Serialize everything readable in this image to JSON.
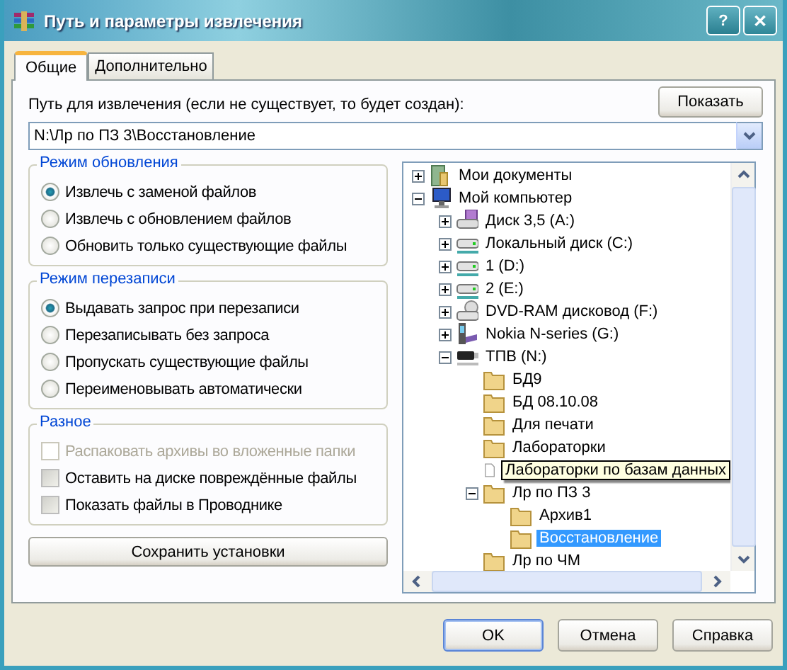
{
  "window": {
    "title": "Путь и параметры извлечения",
    "buttons": [
      {
        "kind": "help",
        "label": "?"
      },
      {
        "kind": "close",
        "label": "✕"
      }
    ]
  },
  "tabs": [
    {
      "label": "Общие",
      "selected": true
    },
    {
      "label": "Дополнительно",
      "selected": false
    }
  ],
  "path": {
    "label": "Путь для извлечения (если не существует, то будет создан):",
    "show_button": "Показать",
    "value": "N:\\Лр по ПЗ 3\\Восстановление"
  },
  "groups": [
    {
      "title": "Режим обновления",
      "options": [
        {
          "label": "Извлечь с заменой файлов",
          "selected": true
        },
        {
          "label": "Извлечь с обновлением файлов",
          "selected": false
        },
        {
          "label": "Обновить только существующие файлы",
          "selected": false
        }
      ]
    },
    {
      "title": "Режим перезаписи",
      "options": [
        {
          "label": "Выдавать запрос при перезаписи",
          "selected": true
        },
        {
          "label": "Перезаписывать без запроса",
          "selected": false
        },
        {
          "label": "Пропускать существующие файлы",
          "selected": false
        },
        {
          "label": "Переименовывать автоматически",
          "selected": false
        }
      ]
    }
  ],
  "misc": {
    "title": "Разное",
    "options": [
      {
        "label": "Распаковать архивы во вложенные папки",
        "checked": false,
        "disabled": true
      },
      {
        "label": "Оставить на диске повреждённые файлы",
        "checked": false,
        "disabled": false
      },
      {
        "label": "Показать файлы в Проводнике",
        "checked": false,
        "disabled": false
      }
    ]
  },
  "save_button": "Сохранить установки",
  "tree": [
    {
      "label": "Мои документы",
      "kind": "documents",
      "expanded": false
    },
    {
      "label": "Мой компьютер",
      "kind": "computer",
      "expanded": true,
      "children": [
        {
          "label": "Диск 3,5 (A:)",
          "kind": "floppy",
          "expanded": false
        },
        {
          "label": "Локальный диск (C:)",
          "kind": "drive",
          "expanded": false
        },
        {
          "label": "1 (D:)",
          "kind": "drive",
          "expanded": false
        },
        {
          "label": "2 (E:)",
          "kind": "drive",
          "expanded": false
        },
        {
          "label": "DVD-RAM дисковод (F:)",
          "kind": "dvd",
          "expanded": false
        },
        {
          "label": "Nokia N-series (G:)",
          "kind": "phone",
          "expanded": false
        },
        {
          "label": "ТПВ (N:)",
          "kind": "usb",
          "expanded": true,
          "children": [
            {
              "label": "БД9",
              "kind": "folder",
              "selected": false
            },
            {
              "label": "БД 08.10.08",
              "kind": "folder",
              "selected": false
            },
            {
              "label": "Для печати",
              "kind": "folder",
              "selected": false
            },
            {
              "label": "Лабораторки",
              "kind": "folder",
              "selected": false
            },
            {
              "label": "Лабораторки по базам данных",
              "kind": "file",
              "selected": false,
              "tooltip": true
            },
            {
              "label": "Лр по ПЗ 3",
              "kind": "folder",
              "expanded": true,
              "selected": false,
              "children": [
                {
                  "label": "Архив1",
                  "kind": "folder",
                  "selected": false
                },
                {
                  "label": "Восстановление",
                  "kind": "folder",
                  "selected": true
                }
              ]
            },
            {
              "label": "Лр по ЧМ",
              "kind": "folder",
              "selected": false
            }
          ]
        }
      ]
    }
  ],
  "footer_buttons": [
    {
      "label": "OK",
      "default": true
    },
    {
      "label": "Отмена",
      "default": false
    },
    {
      "label": "Справка",
      "default": false
    }
  ]
}
